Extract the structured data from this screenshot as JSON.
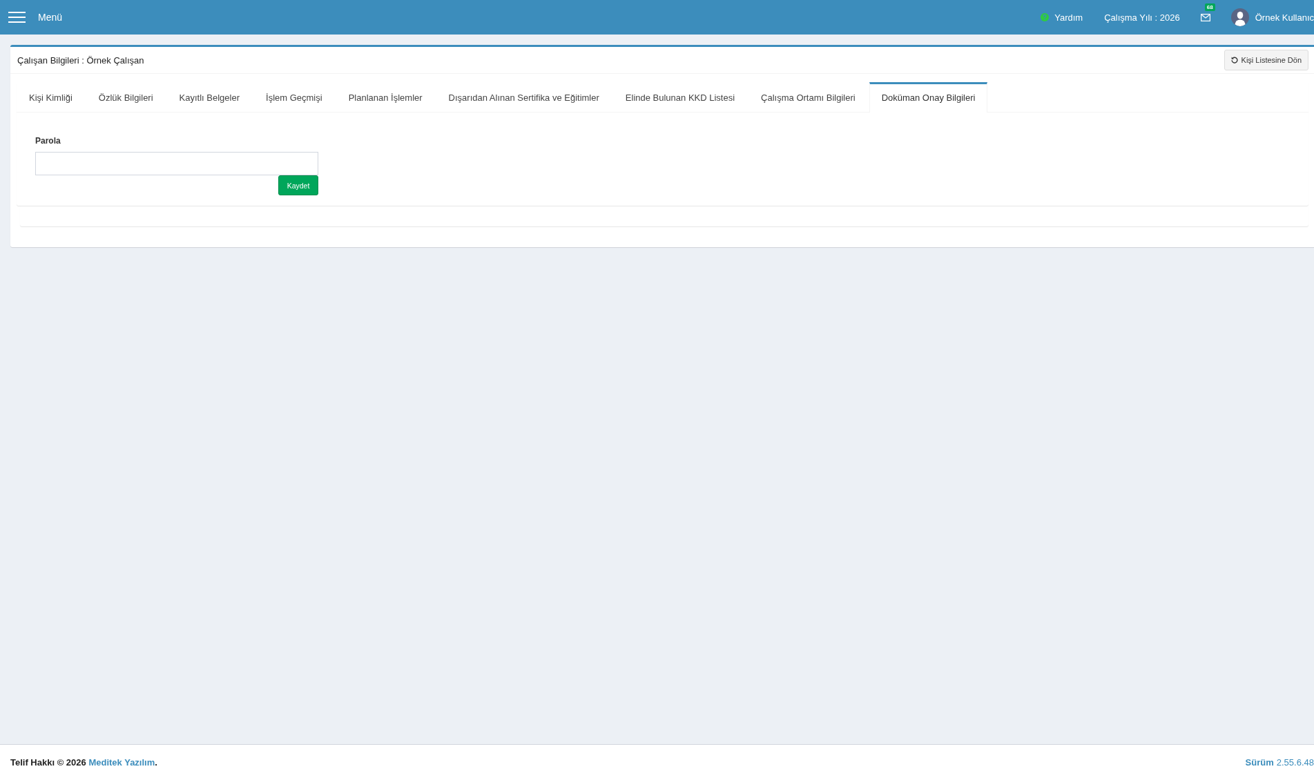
{
  "header": {
    "menu_label": "Menü",
    "help_label": "Yardım",
    "work_year": "Çalışma Yılı : 2026",
    "mail_count": "68",
    "user_name": "Örnek Kullanıc"
  },
  "card": {
    "title": "Çalışan Bilgileri : Örnek Çalışan",
    "back_button": "Kişi Listesine Dön"
  },
  "tabs": [
    {
      "label": "Kişi Kimliği",
      "selected": false
    },
    {
      "label": "Özlük Bilgileri",
      "selected": false
    },
    {
      "label": "Kayıtlı Belgeler",
      "selected": false
    },
    {
      "label": "İşlem Geçmişi",
      "selected": false
    },
    {
      "label": "Planlanan İşlemler",
      "selected": false
    },
    {
      "label": "Dışarıdan Alınan Sertifika ve Eğitimler",
      "selected": false
    },
    {
      "label": "Elinde Bulunan KKD Listesi",
      "selected": false
    },
    {
      "label": "Çalışma Ortamı Bilgileri",
      "selected": false
    },
    {
      "label": "Doküman Onay Bilgileri",
      "selected": true
    }
  ],
  "form": {
    "password_label": "Parola",
    "save_button": "Kaydet"
  },
  "footer": {
    "copyright": "Telif Hakkı © 2026",
    "company_link": "Meditek Yazılım",
    "copyright_end": ".",
    "version_label": "Sürüm",
    "version_number": "2.55.6.48"
  }
}
